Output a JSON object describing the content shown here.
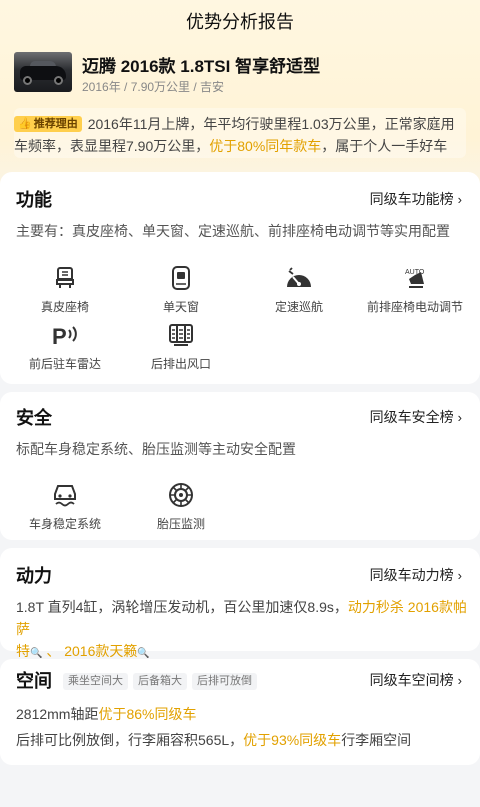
{
  "nav": {
    "title": "优势分析报告"
  },
  "car": {
    "name": "迈腾 2016款 1.8TSI 智享舒适型",
    "meta": "2016年 / 7.90万公里 / 吉安"
  },
  "reason": {
    "badge": "推荐理由",
    "text_a": "2016年11月上牌，年平均行驶里程1.03万公里，正常家庭用车频率，表显里程7.90万公里，",
    "highlight": "优于80%同年款车",
    "text_b": "，属于个人一手好车"
  },
  "function": {
    "title": "功能",
    "link": "同级车功能榜",
    "desc": "主要有：真皮座椅、单天窗、定速巡航、前排座椅电动调节等实用配置",
    "items": [
      {
        "label": "真皮座椅",
        "icon": "leather-seat-icon"
      },
      {
        "label": "单天窗",
        "icon": "sunroof-icon"
      },
      {
        "label": "定速巡航",
        "icon": "cruise-control-icon"
      },
      {
        "label": "前排座椅电动调节",
        "icon": "power-seat-icon"
      },
      {
        "label": "前后驻车雷达",
        "icon": "parking-radar-icon"
      },
      {
        "label": "后排出风口",
        "icon": "rear-air-vent-icon"
      }
    ]
  },
  "safety": {
    "title": "安全",
    "link": "同级车安全榜",
    "desc": "标配车身稳定系统、胎压监测等主动安全配置",
    "items": [
      {
        "label": "车身稳定系统",
        "icon": "stability-control-icon"
      },
      {
        "label": "胎压监测",
        "icon": "tire-pressure-icon"
      }
    ]
  },
  "power": {
    "title": "动力",
    "link": "同级车动力榜",
    "text": "1.8T 直列4缸，涡轮增压发动机，百公里加速仅8.9s，",
    "highlight_a": "动力秒杀 2016款帕萨",
    "highlight_b": "特",
    "sep": " 、 ",
    "highlight_c": "2016款天籁"
  },
  "space": {
    "title": "空间",
    "link": "同级车空间榜",
    "tags": [
      "乘坐空间大",
      "后备箱大",
      "后排可放倒"
    ],
    "line1_text": "2812mm轴距",
    "line1_hl": "优于86%同级车",
    "line2_text": "后排可比例放倒，行李厢容积565L，",
    "line2_hl": "优于93%同级车",
    "line2_tail": "行李厢空间"
  },
  "colors": {
    "accent": "#e2a100",
    "badge": "#ffcf4d",
    "header_bg": "#fff5dc"
  }
}
